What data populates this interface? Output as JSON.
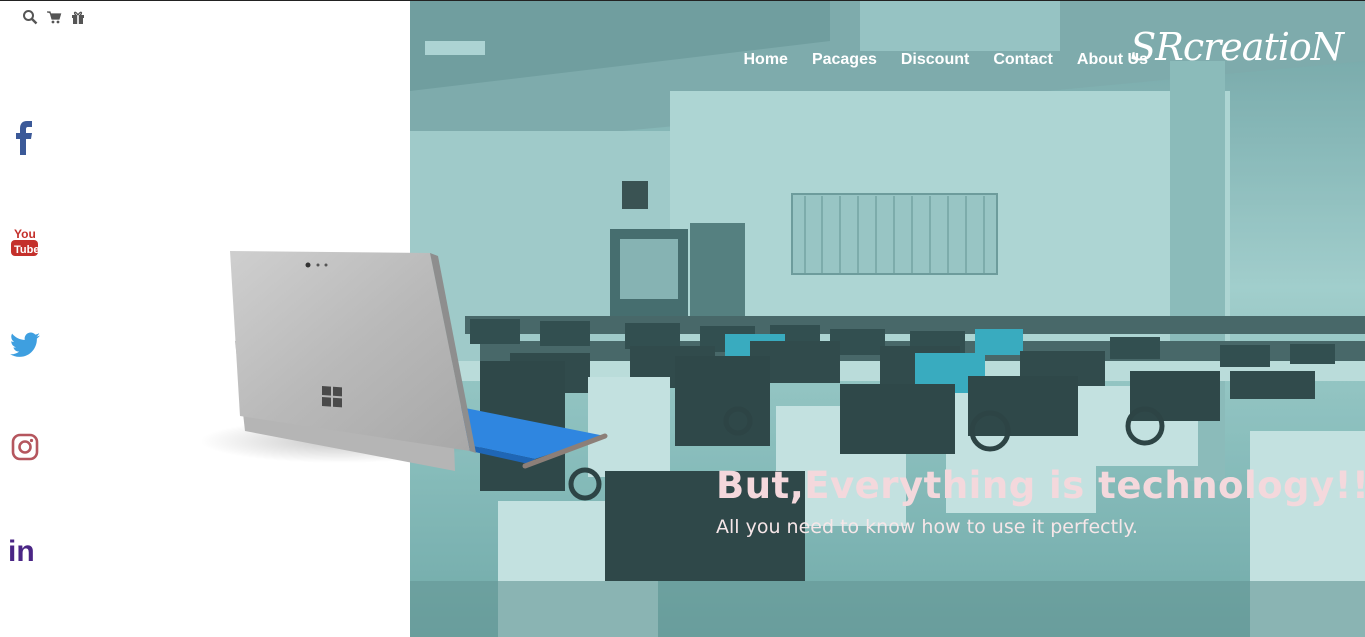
{
  "utility": {
    "icons": [
      "search-icon",
      "cart-icon",
      "gift-icon"
    ]
  },
  "social": {
    "items": [
      {
        "name": "facebook-icon",
        "color": "#3b5998"
      },
      {
        "name": "youtube-icon",
        "color": "#c4302b",
        "text_top": "You",
        "text_bottom": "Tube"
      },
      {
        "name": "twitter-icon",
        "color": "#3e9fe0"
      },
      {
        "name": "instagram-icon",
        "color": "#b5565e"
      },
      {
        "name": "linkedin-icon",
        "color": "#4a2585",
        "text": "in"
      }
    ]
  },
  "nav": {
    "items": [
      "Home",
      "Pacages",
      "Discount",
      "Contact",
      "About Us"
    ]
  },
  "brand": {
    "name": "SRcreatioN"
  },
  "hero": {
    "headline": "But,Everything is technology!!!",
    "subline": "All you need to know how to use it perfectly."
  },
  "colors": {
    "hero_tint": "#8cc0be",
    "headline": "#f4d8dc",
    "nav_text": "#ffffff"
  }
}
